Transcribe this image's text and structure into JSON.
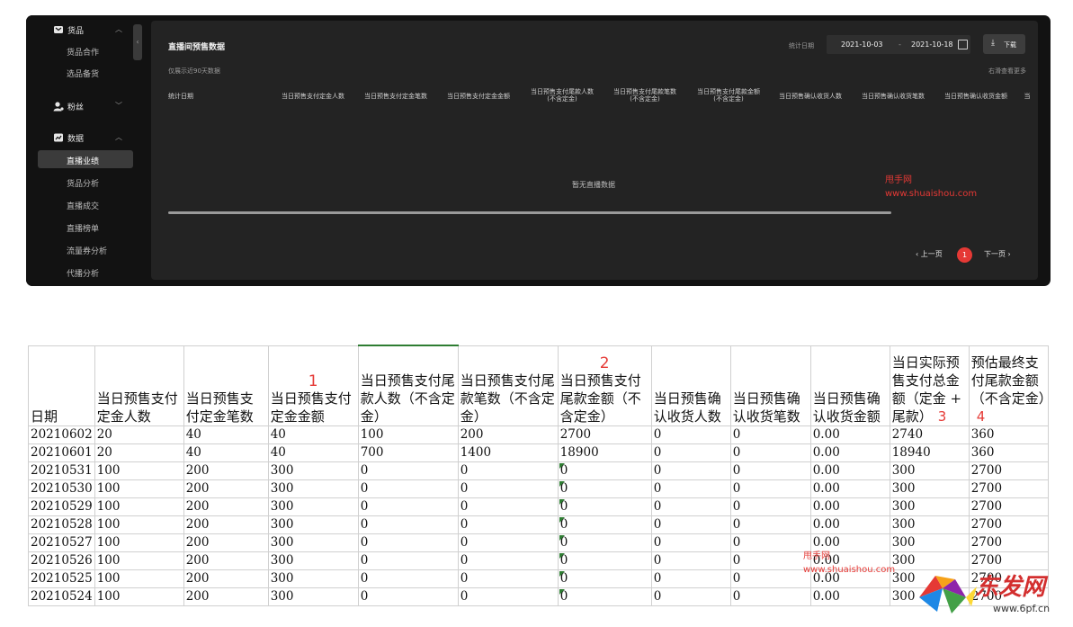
{
  "sidebar": {
    "groups": [
      {
        "label": "货品",
        "items": [
          "货品合作",
          "选品备货"
        ]
      },
      {
        "label": "粉丝",
        "items": []
      },
      {
        "label": "数据",
        "items": [
          "直播业绩",
          "货品分析",
          "直播成交",
          "直播榜单",
          "流量券分析",
          "代播分析"
        ]
      }
    ],
    "active_item": "直播业绩"
  },
  "main": {
    "title": "直播间预售数据",
    "note": "仅展示近90天数据",
    "scroll_hint": "右滑查看更多",
    "date_label": "统计日期",
    "date_start": "2021-10-03",
    "date_sep": "-",
    "date_end": "2021-10-18",
    "download_label": "下载",
    "columns": [
      "统计日期",
      "当日预售支付定金人数",
      "当日预售支付定金笔数",
      "当日预售支付定金金额",
      "当日预售支付尾款人数\n(不含定金)",
      "当日预售支付尾款笔数\n(不含定金)",
      "当日预售支付尾款金额\n(不含定金)",
      "当日预售确认收货人数",
      "当日预售确认收货笔数",
      "当日预售确认收货金额",
      "当"
    ],
    "empty_text": "暂无直播数据",
    "pager": {
      "prev": "上一页",
      "current": "1",
      "next": "下一页"
    }
  },
  "watermark": {
    "line1": "甩手网",
    "line2": "www.shuaishou.com"
  },
  "sheet": {
    "headers": [
      {
        "text": "日期",
        "marker": ""
      },
      {
        "text": "当日预售支付定金人数",
        "marker": ""
      },
      {
        "text": "当日预售支付定金笔数",
        "marker": ""
      },
      {
        "text": "当日预售支付定金金额",
        "marker": "1"
      },
      {
        "text": "当日预售支付尾款人数（不含定金）",
        "marker": ""
      },
      {
        "text": "当日预售支付尾款笔数（不含定金）",
        "marker": ""
      },
      {
        "text": "当日预售支付尾款金额（不含定金）",
        "marker": "2"
      },
      {
        "text": "当日预售确认收货人数",
        "marker": ""
      },
      {
        "text": "当日预售确认收货笔数",
        "marker": ""
      },
      {
        "text": "当日预售确认收货金额",
        "marker": ""
      },
      {
        "text": "当日实际预售支付总金额（定金 + 尾款）",
        "marker": "3"
      },
      {
        "text": "预估最终支付尾款金额（不含定金）",
        "marker": "4"
      }
    ],
    "rows": [
      [
        "20210602",
        "20",
        "40",
        "40",
        "100",
        "200",
        "2700",
        "0",
        "0",
        "0.00",
        "2740",
        "360"
      ],
      [
        "20210601",
        "20",
        "40",
        "40",
        "700",
        "1400",
        "18900",
        "0",
        "0",
        "0.00",
        "18940",
        "360"
      ],
      [
        "20210531",
        "100",
        "200",
        "300",
        "0",
        "0",
        "0",
        "0",
        "0",
        "0.00",
        "300",
        "2700"
      ],
      [
        "20210530",
        "100",
        "200",
        "300",
        "0",
        "0",
        "0",
        "0",
        "0",
        "0.00",
        "300",
        "2700"
      ],
      [
        "20210529",
        "100",
        "200",
        "300",
        "0",
        "0",
        "0",
        "0",
        "0",
        "0.00",
        "300",
        "2700"
      ],
      [
        "20210528",
        "100",
        "200",
        "300",
        "0",
        "0",
        "0",
        "0",
        "0",
        "0.00",
        "300",
        "2700"
      ],
      [
        "20210527",
        "100",
        "200",
        "300",
        "0",
        "0",
        "0",
        "0",
        "0",
        "0.00",
        "300",
        "2700"
      ],
      [
        "20210526",
        "100",
        "200",
        "300",
        "0",
        "0",
        "0",
        "0",
        "0",
        "0.00",
        "300",
        "2700"
      ],
      [
        "20210525",
        "100",
        "200",
        "300",
        "0",
        "0",
        "0",
        "0",
        "0",
        "0.00",
        "300",
        "2700"
      ],
      [
        "20210524",
        "100",
        "200",
        "300",
        "0",
        "0",
        "0",
        "0",
        "0",
        "0.00",
        "300",
        "2700"
      ]
    ]
  },
  "brand_logo_text": "东发网",
  "brand_url": "www.6pf.cn",
  "accent_color": "#e53935"
}
